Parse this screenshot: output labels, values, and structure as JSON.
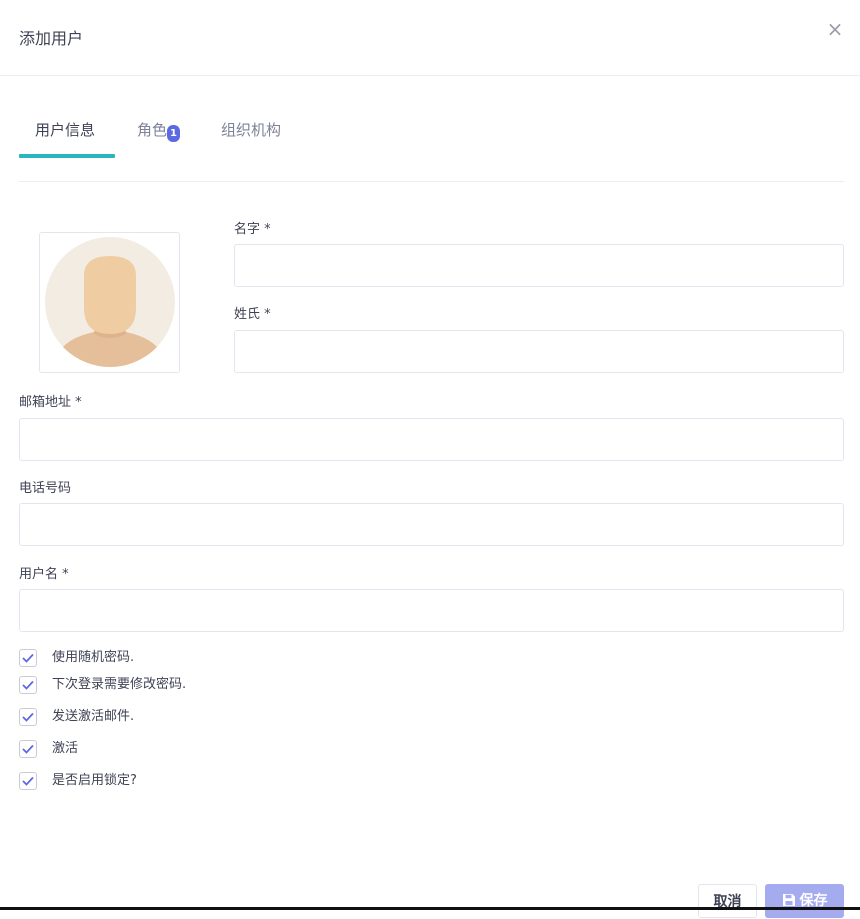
{
  "modal": {
    "title": "添加用户",
    "close_glyph": "×"
  },
  "tabs": [
    {
      "label": "用户信息",
      "active": true
    },
    {
      "label": "角色",
      "badge": "1",
      "active": false
    },
    {
      "label": "组织机构",
      "active": false
    }
  ],
  "form": {
    "first_name": {
      "label": "名字 *",
      "value": ""
    },
    "last_name": {
      "label": "姓氏 *",
      "value": ""
    },
    "email": {
      "label": "邮箱地址 *",
      "value": ""
    },
    "phone": {
      "label": "电话号码",
      "value": ""
    },
    "username": {
      "label": "用户名 *",
      "value": ""
    }
  },
  "options": [
    {
      "label": "使用随机密码.",
      "checked": true
    },
    {
      "label": "下次登录需要修改密码.",
      "checked": true
    },
    {
      "label": "发送激活邮件.",
      "checked": true
    },
    {
      "label": "激活",
      "checked": true
    },
    {
      "label": "是否启用锁定?",
      "checked": true
    }
  ],
  "footer": {
    "cancel_label": "取消",
    "save_label": "保存",
    "save_icon": "save-icon"
  },
  "colors": {
    "accent": "#2ab6c0",
    "badge": "#5b6ae0",
    "save_button": "#a4abee",
    "check": "#5b6ae0"
  }
}
